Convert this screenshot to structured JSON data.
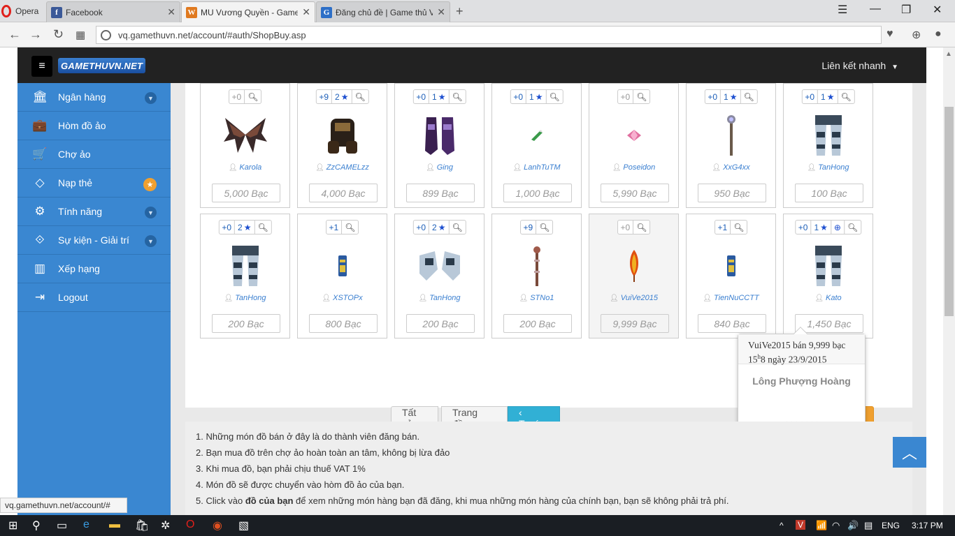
{
  "browser": {
    "opera_label": "Opera",
    "tabs": [
      {
        "title": "Facebook",
        "favicon": "f"
      },
      {
        "title": "MU Vương Quyền - Game",
        "favicon": "W"
      },
      {
        "title": "Đăng chủ đề | Game thủ V",
        "favicon": "G"
      }
    ],
    "url": "vq.gamethuvn.net/account/#auth/ShopBuy.asp",
    "status_url": "vq.gamethuvn.net/account/#"
  },
  "navbar": {
    "logo_text": "GAMETHUVN.NET",
    "quicklink_label": "Liên kết nhanh"
  },
  "sidebar": {
    "items": [
      {
        "label": "Ngân hàng",
        "icon": "bank-icon",
        "glyph": "🏛",
        "extra": "chevron"
      },
      {
        "label": "Hòm đồ ảo",
        "icon": "briefcase-icon",
        "glyph": "💼",
        "extra": ""
      },
      {
        "label": "Chợ ảo",
        "icon": "cart-icon",
        "glyph": "🛒",
        "extra": ""
      },
      {
        "label": "Nạp thẻ",
        "icon": "diamond-icon",
        "glyph": "◇",
        "extra": "star"
      },
      {
        "label": "Tính năng",
        "icon": "gears-icon",
        "glyph": "⚙",
        "extra": "chevron"
      },
      {
        "label": "Sự kiện - Giải trí",
        "icon": "code-icon",
        "glyph": "⟐",
        "extra": "chevron"
      },
      {
        "label": "Xếp hạng",
        "icon": "bar-chart-icon",
        "glyph": "▥",
        "extra": ""
      },
      {
        "label": "Logout",
        "icon": "logout-icon",
        "glyph": "⇥",
        "extra": ""
      }
    ]
  },
  "items_row1": [
    {
      "level": "+0",
      "opt": "",
      "star": false,
      "exc": false,
      "seller": "Karola",
      "price": "5,000 Bạc",
      "img": "wings"
    },
    {
      "level": "+9",
      "opt": "2",
      "star": true,
      "exc": false,
      "seller": "ZzCAMELzz",
      "price": "4,000 Bạc",
      "img": "armor-dark"
    },
    {
      "level": "+0",
      "opt": "1",
      "star": true,
      "exc": false,
      "seller": "Ging",
      "price": "899 Bạc",
      "img": "boots-purple"
    },
    {
      "level": "+0",
      "opt": "1",
      "star": true,
      "exc": false,
      "seller": "LanhTuTM",
      "price": "1,000 Bạc",
      "img": "small-green"
    },
    {
      "level": "+0",
      "opt": "",
      "star": false,
      "exc": false,
      "seller": "Poseidon",
      "price": "5,990 Bạc",
      "img": "gem-pink"
    },
    {
      "level": "+0",
      "opt": "1",
      "star": true,
      "exc": false,
      "seller": "XxG4xx",
      "price": "950 Bạc",
      "img": "staff"
    },
    {
      "level": "+0",
      "opt": "1",
      "star": true,
      "exc": false,
      "seller": "TanHong",
      "price": "100 Bạc",
      "img": "pants-silver"
    }
  ],
  "items_row2": [
    {
      "level": "+0",
      "opt": "2",
      "star": true,
      "exc": false,
      "seller": "TanHong",
      "price": "200 Bạc",
      "img": "pants-silver"
    },
    {
      "level": "+1",
      "opt": "",
      "star": false,
      "exc": false,
      "seller": "XSTOPx",
      "price": "800 Bạc",
      "img": "scroll-blue"
    },
    {
      "level": "+0",
      "opt": "2",
      "star": true,
      "exc": false,
      "seller": "TanHong",
      "price": "200 Bạc",
      "img": "gloves-silver"
    },
    {
      "level": "+9",
      "opt": "",
      "star": false,
      "exc": false,
      "seller": "STNo1",
      "price": "200 Bạc",
      "img": "staff-brown"
    },
    {
      "level": "+0",
      "opt": "",
      "star": false,
      "exc": false,
      "seller": "VuiVe2015",
      "price": "9,999 Bạc",
      "img": "feather"
    },
    {
      "level": "+1",
      "opt": "",
      "star": false,
      "exc": false,
      "seller": "TienNuCCTT",
      "price": "840 Bạc",
      "img": "scroll-blue"
    },
    {
      "level": "+0",
      "opt": "1",
      "star": true,
      "exc": true,
      "seller": "Kato",
      "price": "1,450 Bạc",
      "img": "pants-silver"
    }
  ],
  "pagination": {
    "all": "Tất cả",
    "first": "Trang đầu",
    "prev": "‹ Trước"
  },
  "tooltip": {
    "line1": "VuiVe2015 bán 9,999 bạc",
    "line2_pre": "15",
    "line2_sup": "h",
    "line2_post": "8 ngày 23/9/2015",
    "item_name": "Lông Phượng Hoàng",
    "stars": "☆☆☆☆☆☆☆"
  },
  "notes": [
    "1. Những món đồ bán ở đây là do thành viên đăng bán.",
    "2. Bạn mua đồ trên chợ ảo hoàn toàn an tâm, không bị lừa đảo",
    "3. Khi mua đồ, bạn phải chịu thuế VAT 1%",
    "4. Món đồ sẽ được chuyển vào hòm đồ ảo của bạn."
  ],
  "note5": {
    "pre": "5. Click vào ",
    "bold": "đồ của bạn",
    "post": " để xem những món hàng bạn đã đăng, khi mua những món hàng của chính bạn, bạn sẽ không phải trả phí."
  },
  "taskbar": {
    "lang": "ENG",
    "time": "3:17 PM"
  },
  "colors": {
    "sidebar": "#3a87d1",
    "navbar": "#222222",
    "pager_active": "#31b0d5",
    "pager_orange": "#f0a030"
  }
}
